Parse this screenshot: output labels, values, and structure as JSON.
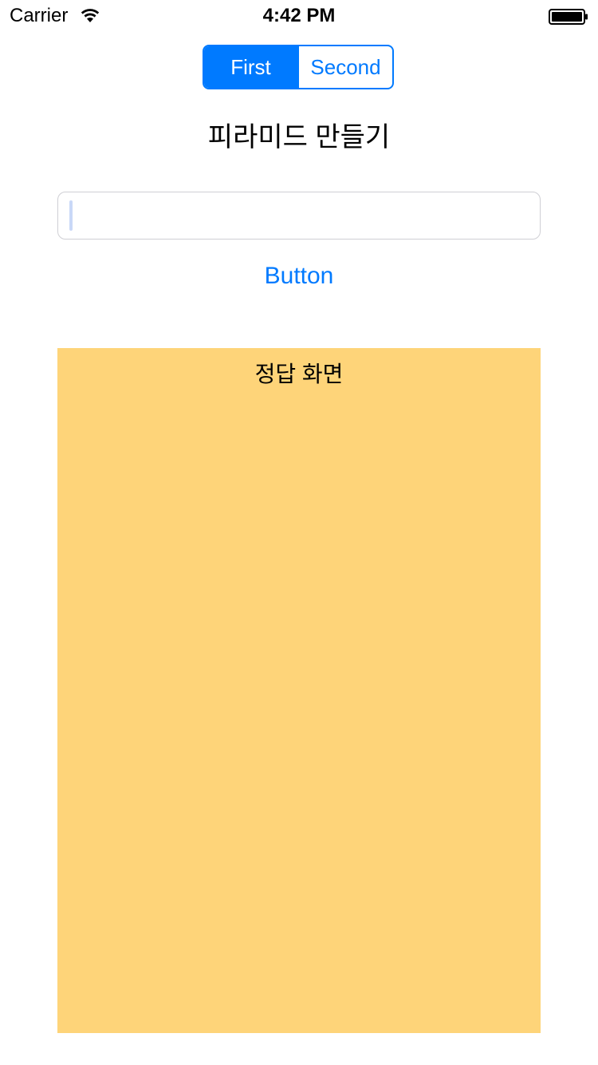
{
  "status_bar": {
    "carrier": "Carrier",
    "time": "4:42 PM",
    "wifi_icon": "wifi-icon",
    "battery_icon": "battery-icon"
  },
  "segmented_control": {
    "segments": [
      {
        "label": "First",
        "selected": true
      },
      {
        "label": "Second",
        "selected": false
      }
    ],
    "accent_color": "#007aff"
  },
  "main": {
    "title": "피라미드 만들기",
    "input": {
      "value": "",
      "placeholder": ""
    },
    "button_label": "Button"
  },
  "answer_panel": {
    "title": "정답 화면",
    "background_color": "#fed479"
  }
}
